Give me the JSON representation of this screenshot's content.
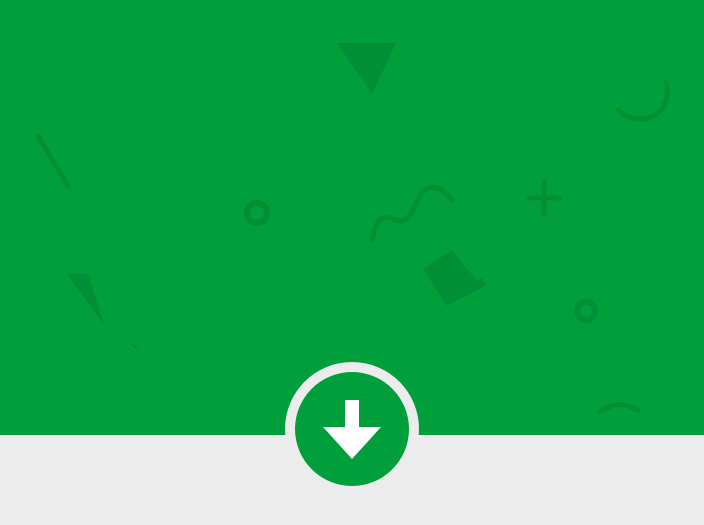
{
  "colors": {
    "brand_green": "#009f3c",
    "background_gray": "#ececec",
    "decoration_shade": "#008f36",
    "icon_white": "#ffffff"
  },
  "download_button": {
    "icon": "arrow-down-icon"
  },
  "decorations": [
    "triangle-shape",
    "line-shape",
    "circle-shape",
    "wave-shape",
    "plus-shape",
    "square-shape",
    "arc-shape"
  ]
}
